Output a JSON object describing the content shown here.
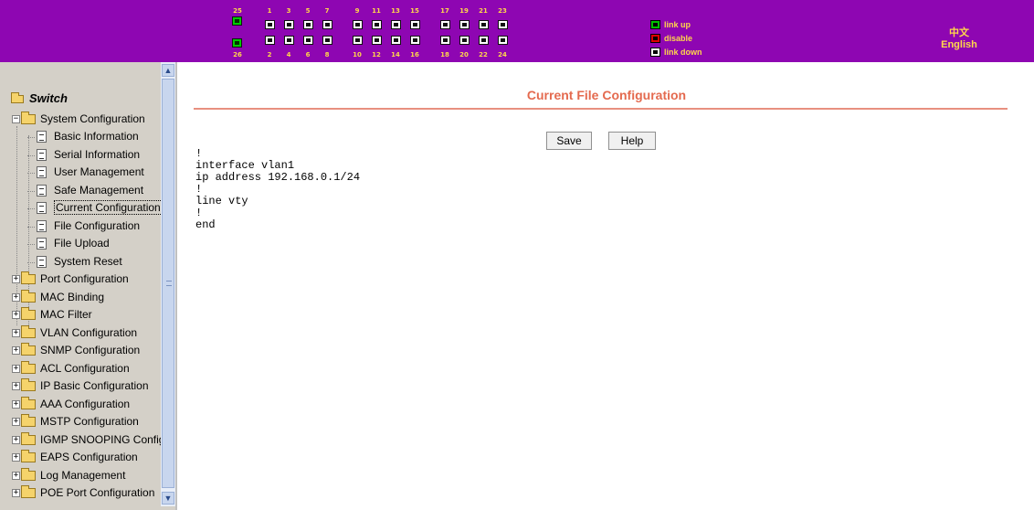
{
  "header": {
    "top_numbers": [
      "1",
      "3",
      "5",
      "7",
      "9",
      "11",
      "13",
      "15",
      "17",
      "19",
      "21",
      "23"
    ],
    "bottom_numbers": [
      "2",
      "4",
      "6",
      "8",
      "10",
      "12",
      "14",
      "16",
      "18",
      "20",
      "22",
      "24"
    ],
    "combo_top": "25",
    "combo_bottom": "26",
    "legend": {
      "up": "link up",
      "disable": "disable",
      "down": "link down"
    },
    "lang_zh": "中文",
    "lang_en": "English",
    "colors": {
      "background": "#8e06b2",
      "label": "#ffd84a",
      "link_up": "#00c000",
      "disable": "#e00000"
    }
  },
  "sidebar": {
    "root": "Switch",
    "expanded_group": "System Configuration",
    "children": [
      "Basic Information",
      "Serial Information",
      "User Management",
      "Safe Management",
      "Current Configuration",
      "File Configuration",
      "File Upload",
      "System Reset"
    ],
    "selected": "Current Configuration",
    "groups": [
      "Port Configuration",
      "MAC Binding",
      "MAC Filter",
      "VLAN Configuration",
      "SNMP Configuration",
      "ACL Configuration",
      "IP Basic Configuration",
      "AAA Configuration",
      "MSTP Configuration",
      "IGMP SNOOPING Config",
      "EAPS Configuration",
      "Log Management",
      "POE Port Configuration"
    ]
  },
  "main": {
    "title": "Current File Configuration",
    "save_label": "Save",
    "help_label": "Help",
    "config_text": "!\ninterface vlan1\nip address 192.168.0.1/24\n!\nline vty\n!\nend",
    "colors": {
      "title": "#e46a4f",
      "rule": "#e89080"
    }
  }
}
